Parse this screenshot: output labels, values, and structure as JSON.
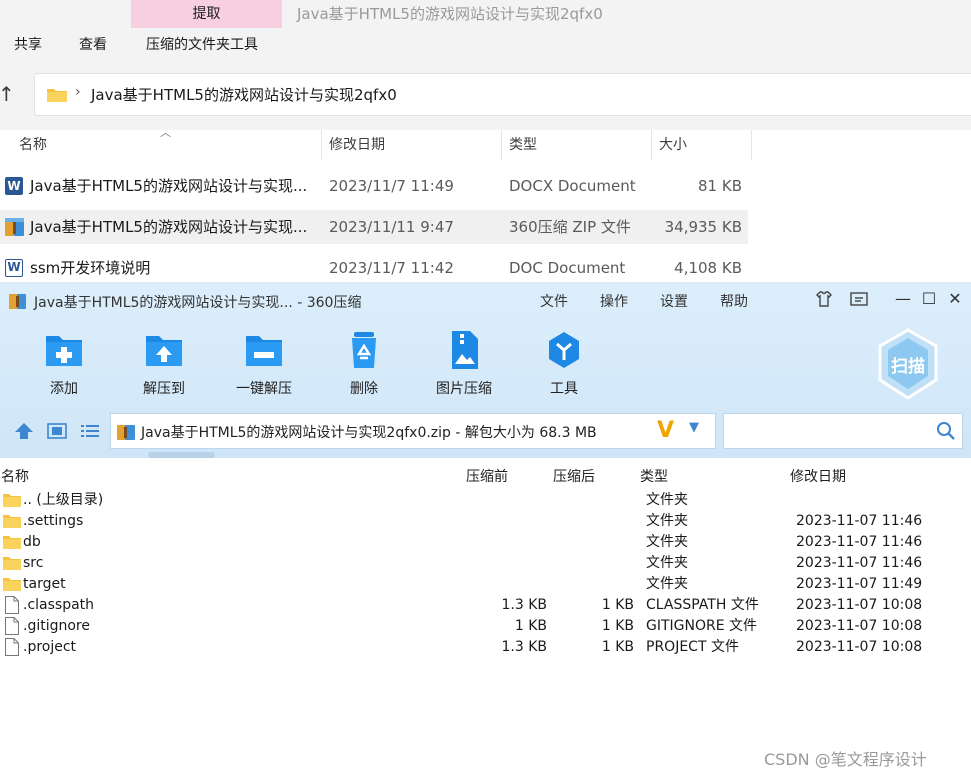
{
  "explorer": {
    "context_tab": "提取",
    "window_title": "Java基于HTML5的游戏网站设计与实现2qfx0",
    "ribbon_tabs": [
      "共享",
      "查看",
      "压缩的文件夹工具"
    ],
    "address": "Java基于HTML5的游戏网站设计与实现2qfx0",
    "columns": [
      "名称",
      "修改日期",
      "类型",
      "大小"
    ],
    "files": [
      {
        "name": "Java基于HTML5的游戏网站设计与实现...",
        "date": "2023/11/7 11:49",
        "type": "DOCX Document",
        "size": "81 KB",
        "icon": "word-icon"
      },
      {
        "name": "Java基于HTML5的游戏网站设计与实现...",
        "date": "2023/11/11 9:47",
        "type": "360压缩 ZIP 文件",
        "size": "34,935 KB",
        "icon": "zip-icon"
      },
      {
        "name": "ssm开发环境说明",
        "date": "2023/11/7 11:42",
        "type": "DOC Document",
        "size": "4,108 KB",
        "icon": "word-icon"
      }
    ]
  },
  "zip": {
    "title": "Java基于HTML5的游戏网站设计与实现... - 360压缩",
    "menu": [
      "文件",
      "操作",
      "设置",
      "帮助"
    ],
    "toolbar": [
      "添加",
      "解压到",
      "一键解压",
      "删除",
      "图片压缩",
      "工具"
    ],
    "scan_label": "扫描",
    "path": "Java基于HTML5的游戏网站设计与实现2qfx0.zip - 解包大小为 68.3 MB",
    "columns": [
      "名称",
      "压缩前",
      "压缩后",
      "类型",
      "修改日期"
    ],
    "rows": [
      {
        "name": ".. (上级目录)",
        "before": "",
        "after": "",
        "type": "文件夹",
        "date": "",
        "kind": "folder"
      },
      {
        "name": ".settings",
        "before": "",
        "after": "",
        "type": "文件夹",
        "date": "2023-11-07 11:46",
        "kind": "folder"
      },
      {
        "name": "db",
        "before": "",
        "after": "",
        "type": "文件夹",
        "date": "2023-11-07 11:46",
        "kind": "folder"
      },
      {
        "name": "src",
        "before": "",
        "after": "",
        "type": "文件夹",
        "date": "2023-11-07 11:46",
        "kind": "folder"
      },
      {
        "name": "target",
        "before": "",
        "after": "",
        "type": "文件夹",
        "date": "2023-11-07 11:49",
        "kind": "folder"
      },
      {
        "name": ".classpath",
        "before": "1.3 KB",
        "after": "1 KB",
        "type": "CLASSPATH 文件",
        "date": "2023-11-07 10:08",
        "kind": "file"
      },
      {
        "name": ".gitignore",
        "before": "1 KB",
        "after": "1 KB",
        "type": "GITIGNORE 文件",
        "date": "2023-11-07 10:08",
        "kind": "file"
      },
      {
        "name": ".project",
        "before": "1.3 KB",
        "after": "1 KB",
        "type": "PROJECT 文件",
        "date": "2023-11-07 10:08",
        "kind": "file"
      }
    ]
  },
  "watermark": "CSDN @笔文程序设计",
  "colors": {
    "accent": "#2b8fe8",
    "context_tab": "#f7cfe0",
    "zip_header": "#d6eafa",
    "word": "#2b5797"
  }
}
